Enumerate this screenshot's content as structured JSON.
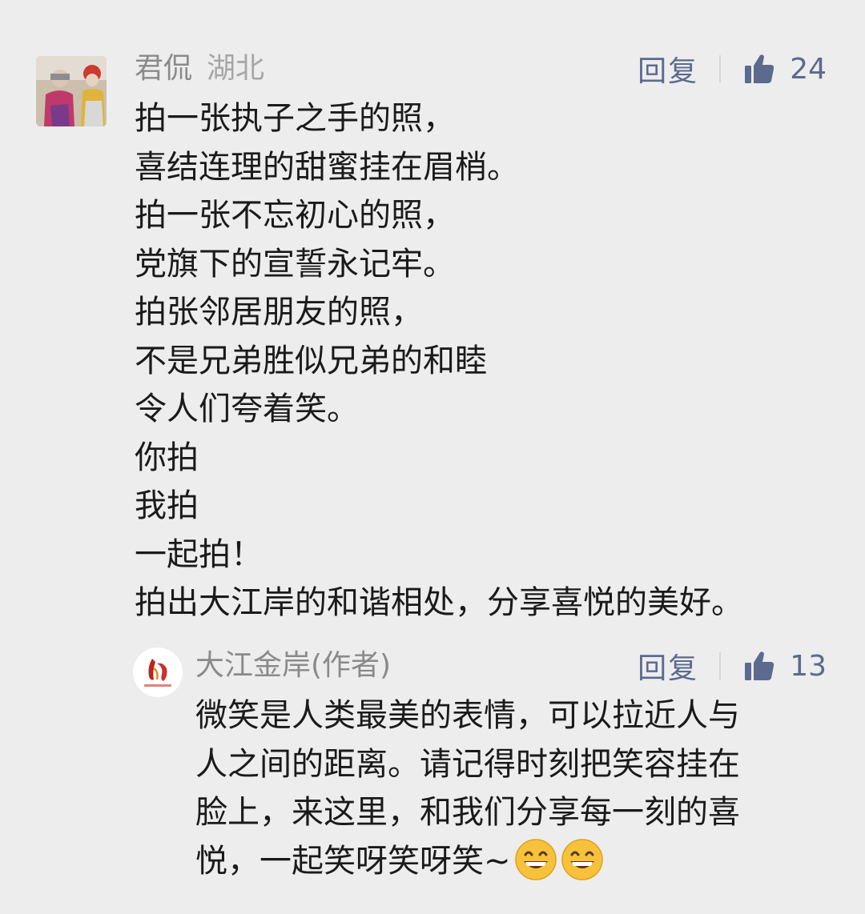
{
  "comment": {
    "author": "君侃",
    "region": "湖北",
    "reply_label": "回复",
    "likes": "24",
    "lines": [
      "拍一张执子之手的照，",
      "喜结连理的甜蜜挂在眉梢。",
      "拍一张不忘初心的照，",
      "党旗下的宣誓永记牢。",
      "拍张邻居朋友的照，",
      "不是兄弟胜似兄弟的和睦",
      "令人们夸着笑。",
      "你拍",
      "我拍",
      "一起拍！",
      "拍出大江岸的和谐相处，分享喜悦的美好。"
    ]
  },
  "reply": {
    "author": "大江金岸(作者)",
    "reply_label": "回复",
    "likes": "13",
    "lines": [
      "微笑是人类最美的表情，可以拉近人与",
      "人之间的距离。请记得时刻把笑容挂在",
      "脸上，来这里，和我们分享每一刻的喜",
      "悦，一起笑呀笑呀笑~"
    ],
    "emojis": [
      "grinning-face-emoji",
      "grinning-face-emoji"
    ]
  },
  "colors": {
    "background": "#ededed",
    "action_blue": "#5b6a8e",
    "meta_gray": "#8a8a8a",
    "text": "#1a1a1a"
  }
}
